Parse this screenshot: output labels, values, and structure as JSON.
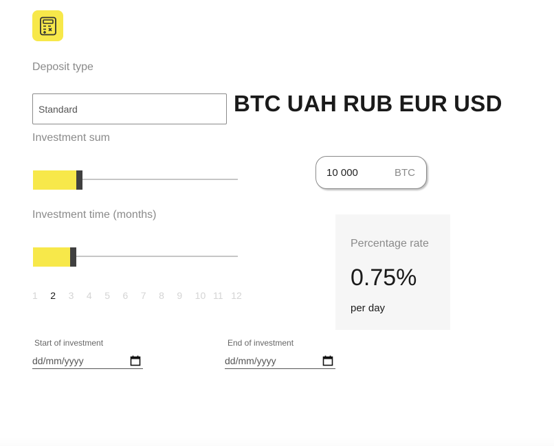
{
  "logo": {
    "icon": "calculator-icon",
    "color": "#f7e84a"
  },
  "deposit": {
    "label": "Deposit type",
    "value": "Standard"
  },
  "currencies": [
    "BTC",
    "UAH",
    "RUB",
    "EUR",
    "USD"
  ],
  "investment_sum": {
    "label": "Investment sum",
    "slider_fraction": 0.21,
    "amount_value": "10 000",
    "amount_unit": "BTC"
  },
  "investment_time": {
    "label": "Investment time (months)",
    "slider_fraction": 0.18,
    "months": [
      "1",
      "2",
      "3",
      "4",
      "5",
      "6",
      "7",
      "8",
      "9",
      "10",
      "11",
      "12"
    ],
    "selected_month": "2"
  },
  "rate": {
    "label": "Percentage rate",
    "value": "0.75%",
    "unit": "per day"
  },
  "dates": {
    "start_label": "Start of investment",
    "start_placeholder": "dd/mm/yyyy",
    "end_label": "End of investment",
    "end_placeholder": "dd/mm/yyyy"
  },
  "colors": {
    "accent": "#f7e84a",
    "thumb": "#404040"
  }
}
